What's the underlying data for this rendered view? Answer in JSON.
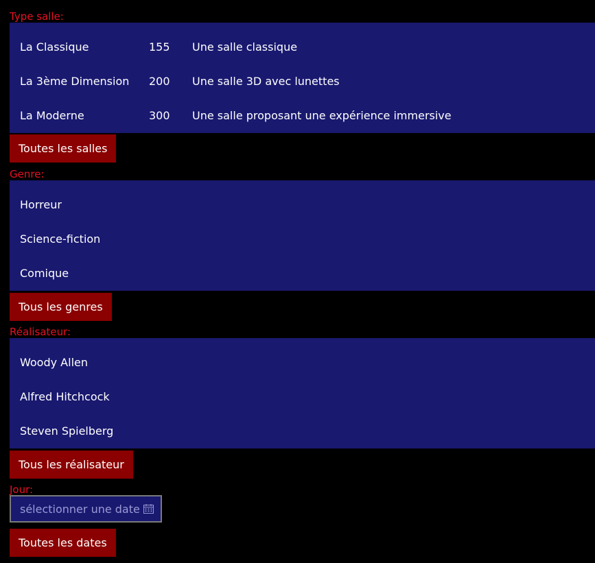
{
  "colors": {
    "background": "#000000",
    "label": "#e81123",
    "panel": "#191970",
    "button": "#8b0000",
    "text": "#ffffff",
    "placeholder": "#9a9ad6"
  },
  "salle": {
    "label": "Type salle:",
    "rows": [
      {
        "name": "La Classique",
        "capacity": "155",
        "description": "Une salle classique"
      },
      {
        "name": "La 3ème Dimension",
        "capacity": "200",
        "description": "Une salle 3D avec lunettes"
      },
      {
        "name": "La Moderne",
        "capacity": "300",
        "description": "Une salle proposant une expérience immersive"
      }
    ],
    "reset_label": "Toutes les salles"
  },
  "genre": {
    "label": "Genre:",
    "rows": [
      {
        "name": "Horreur"
      },
      {
        "name": "Science-fiction"
      },
      {
        "name": "Comique"
      }
    ],
    "reset_label": "Tous les genres"
  },
  "realisateur": {
    "label": "Réalisateur:",
    "rows": [
      {
        "name": "Woody Allen"
      },
      {
        "name": "Alfred Hitchcock"
      },
      {
        "name": "Steven Spielberg"
      }
    ],
    "reset_label": "Tous les réalisateur"
  },
  "jour": {
    "label": "Jour:",
    "placeholder": "sélectionner une date",
    "icon": "calendar-icon",
    "reset_label": "Toutes les dates"
  }
}
